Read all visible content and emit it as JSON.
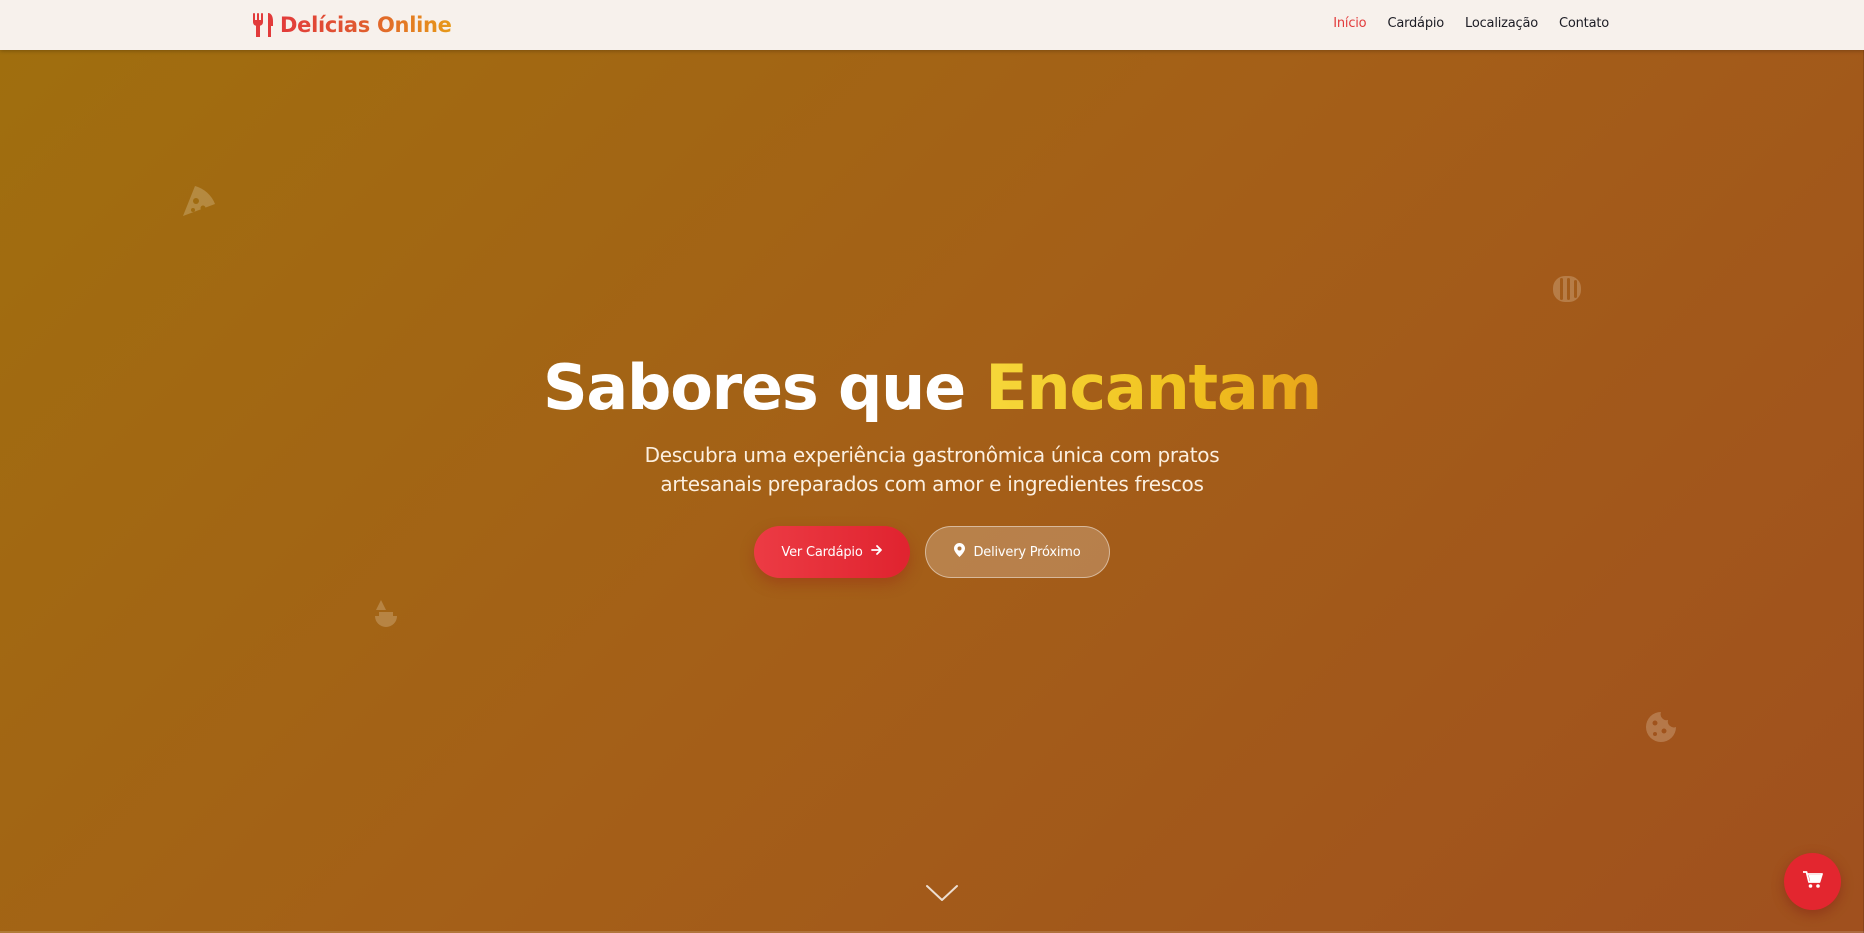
{
  "brand": {
    "name": "Delícias Online",
    "icon": "utensils-icon",
    "gradient": [
      "#e23b3b",
      "#e79a18"
    ]
  },
  "nav": {
    "items": [
      {
        "label": "Início",
        "active": true
      },
      {
        "label": "Cardápio",
        "active": false
      },
      {
        "label": "Localização",
        "active": false
      },
      {
        "label": "Contato",
        "active": false
      }
    ]
  },
  "hero": {
    "title_prefix": "Sabores que ",
    "title_accent": "Encantam",
    "subtitle_line1": "Descubra uma experiência gastronômica única com pratos",
    "subtitle_line2": "artesanais preparados com amor e ingredientes frescos",
    "primary_button": "Ver Cardápio",
    "secondary_button": "Delivery Próximo"
  },
  "decor_icons": [
    "pizza-slice-icon",
    "bread-icon",
    "ice-cream-icon",
    "cookie-icon"
  ],
  "colors": {
    "accent": "#e23b3b",
    "title_accent": "#f0c21f",
    "background_start": "#a06f0e",
    "background_end": "#a0501e",
    "header_bg": "#f7f1ec"
  },
  "cart": {
    "icon": "cart-icon"
  },
  "scroll_hint": {
    "icon": "chevron-down-icon"
  }
}
